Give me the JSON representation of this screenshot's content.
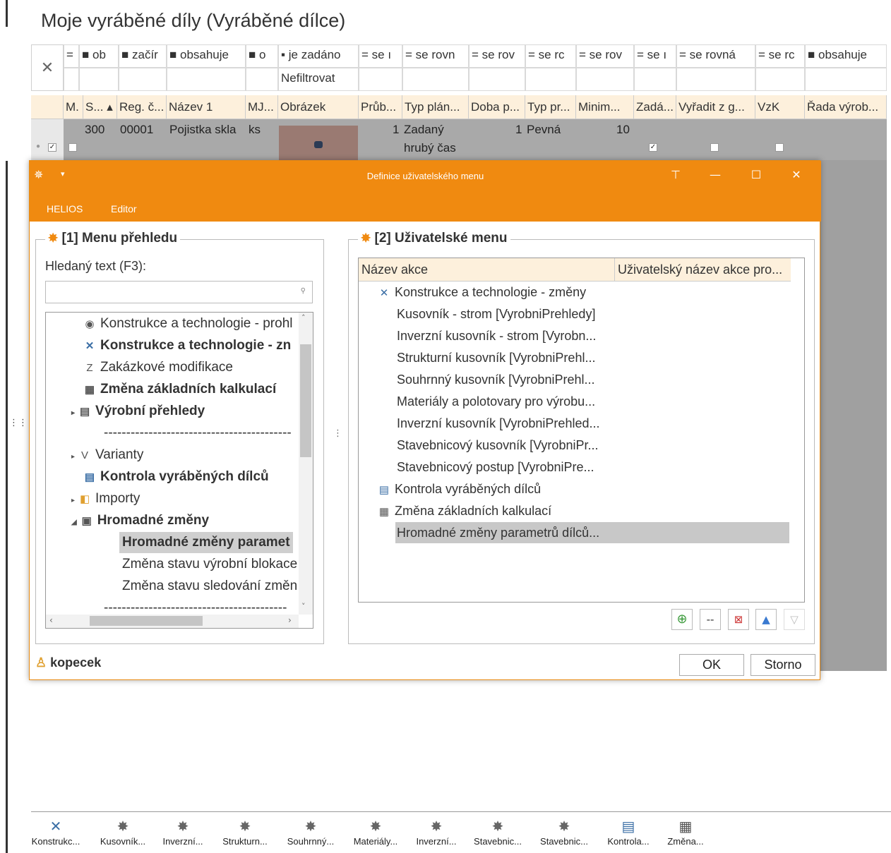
{
  "page_title": "Moje vyráběné díly (Vyráběné dílce)",
  "filter_row": {
    "ops": [
      "=",
      "■ ob",
      "■ začír",
      "■ obsahuje",
      "■ o",
      "▪ je zadáno",
      "= se ı",
      "= se rovn",
      "= se rov",
      "= se rc",
      "= se rov",
      "= se ı",
      "= se rovná",
      "= se rc",
      "■ obsahuje"
    ],
    "nefiltrovat": "Nefiltrovat"
  },
  "grid": {
    "headers": [
      "M.",
      "S... ▴",
      "Reg. č...",
      "Název 1",
      "MJ...",
      "Obrázek",
      "Průb...",
      "Typ plán...",
      "Doba p...",
      "Typ pr...",
      "Minim...",
      "Zadá...",
      "Vyřadit z g...",
      "VzK",
      "Řada výrob..."
    ],
    "row": {
      "s": "300",
      "reg": "00001",
      "name": "Pojistka skla",
      "mj": "ks",
      "prub": "1",
      "typ_plan_1": "Zadaný",
      "typ_plan_2": "hrubý čas",
      "doba": "1",
      "typ_pr": "Pevná",
      "minim": "10"
    }
  },
  "dialog": {
    "title": "Definice uživatelského menu",
    "tabs": [
      "HELIOS",
      "Editor"
    ],
    "left_group": "[1] Menu přehledu",
    "search_label": "Hledaný text (F3):",
    "search_value": "",
    "left_tree": [
      {
        "label": "Konstrukce a technologie - prohl",
        "icon": "eye-icon"
      },
      {
        "label": "Konstrukce a technologie - zn",
        "icon": "tools-icon"
      },
      {
        "label": "Zakázkové modifikace",
        "icon": "z-icon"
      },
      {
        "label": "Změna základních kalkulací",
        "icon": "calculator-icon"
      },
      {
        "label": "Výrobní přehledy",
        "icon": "list-icon"
      },
      {
        "label": "------------------------------------------",
        "icon": ""
      },
      {
        "label": "Varianty",
        "icon": "v-icon"
      },
      {
        "label": "Kontrola vyráběných dílců",
        "icon": "inspect-icon"
      },
      {
        "label": "Importy",
        "icon": "import-icon"
      },
      {
        "label": "Hromadné změny",
        "icon": "clipboard-icon"
      },
      {
        "label": "Hromadné změny paramet",
        "icon": ""
      },
      {
        "label": "Změna stavu výrobní blokace",
        "icon": ""
      },
      {
        "label": "Změna stavu sledování změn",
        "icon": ""
      },
      {
        "label": "-----------------------------------------",
        "icon": ""
      }
    ],
    "right_group": "[2] Uživatelské menu",
    "right_cols": [
      "Název akce",
      "Uživatelský název akce pro..."
    ],
    "right_tree": [
      "Konstrukce a technologie - změny",
      "Kusovník - strom [VyrobniPrehledy]",
      "Inverzní kusovník - strom [Vyrobn...",
      "Strukturní kusovník [VyrobniPrehl...",
      "Souhrnný kusovník [VyrobniPrehl...",
      "Materiály a polotovary pro výrobu...",
      "Inverzní kusovník [VyrobniPrehled...",
      "Stavebnicový kusovník [VyrobniPr...",
      "Stavebnicový postup [VyrobniPre...",
      "Kontrola vyráběných dílců",
      "Změna základních kalkulací",
      "Hromadné změny parametrů dílců..."
    ],
    "toolbar": {
      "separator_label": "--"
    },
    "user": "kopecek",
    "ok": "OK",
    "cancel": "Storno"
  },
  "taskbar": [
    "Konstrukc...",
    "Kusovník...",
    "Inverzní...",
    "Strukturn...",
    "Souhrnný...",
    "Materiály...",
    "Inverzní...",
    "Stavebnic...",
    "Stavebnic...",
    "Kontrola...",
    "Změna..."
  ],
  "colors": {
    "accent": "#f08a10",
    "header_bg": "#fdf0dc",
    "selected": "#c8c8c8"
  }
}
